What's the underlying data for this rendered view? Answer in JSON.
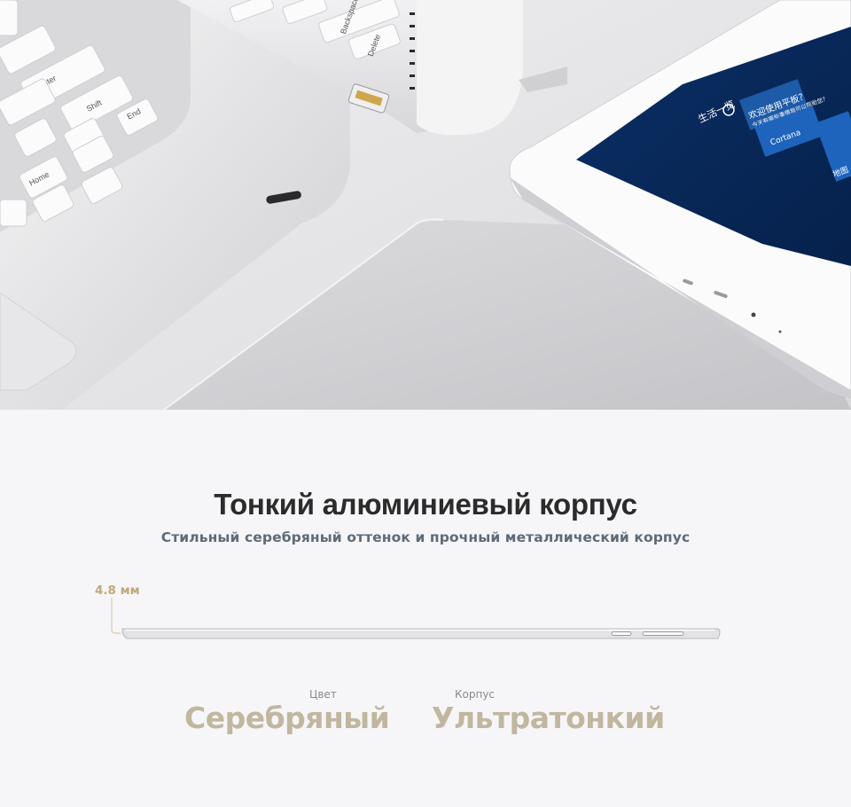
{
  "hero": {
    "keyboard_labels": {
      "enter": "Enter",
      "shift": "Shift",
      "end": "End",
      "home": "Home",
      "backspace": "Backspace",
      "delete": "Delete"
    },
    "screen": {
      "header": "生活一览",
      "greeting": "欢迎使用平板？",
      "greeting_sub": "今天有哪些事情我可以帮助您？",
      "tile_label": "Cortana",
      "tile_label_2": "地图"
    }
  },
  "content": {
    "title": "Тонкий алюминиевый корпус",
    "subtitle": "Стильный серебряный оттенок и прочный металлический корпус",
    "thickness": "4.8 мм",
    "specs": [
      {
        "label": "Цвет",
        "value": "Серебряный"
      },
      {
        "label": "Корпус",
        "value": "Ультратонкий"
      }
    ]
  },
  "colors": {
    "accent_gold": "#bfa979",
    "spec_value": "#c1b79f",
    "screen_blue": "#0b3a78"
  }
}
